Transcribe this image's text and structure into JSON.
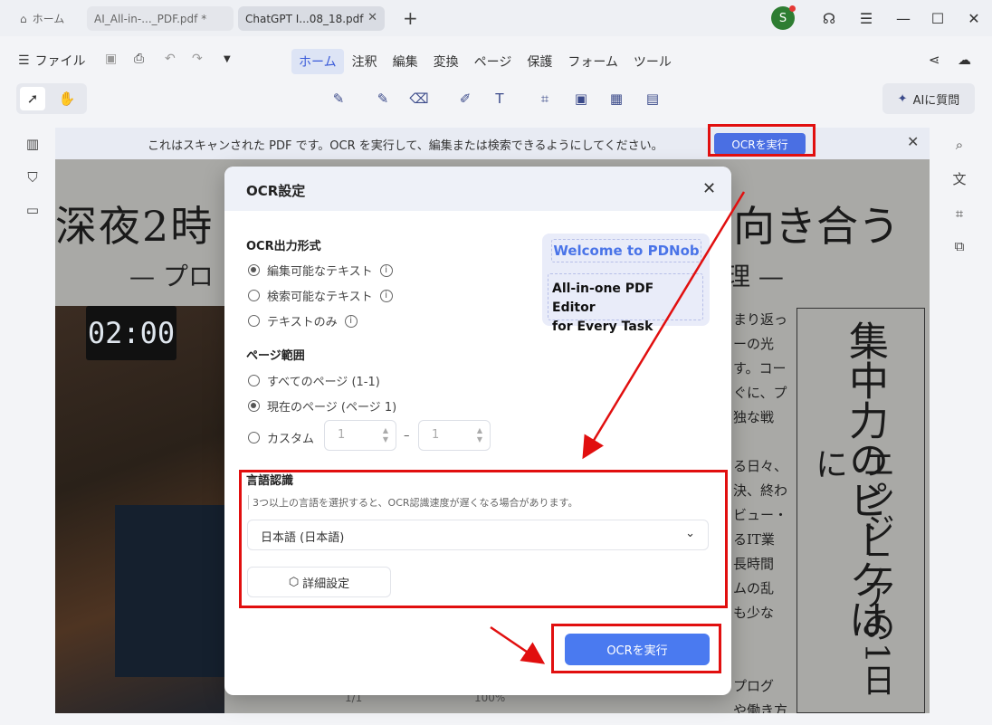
{
  "tabs": [
    {
      "label": "ホーム",
      "icon": "home-icon"
    },
    {
      "label": "AI_All-in-..._PDF.pdf *"
    },
    {
      "label": "ChatGPT I...08_18.pdf"
    }
  ],
  "avatar": {
    "initial": "S"
  },
  "menubar": {
    "file_label": "ファイル",
    "tabs": [
      "ホーム",
      "注釈",
      "編集",
      "変換",
      "ページ",
      "保護",
      "フォーム",
      "ツール"
    ],
    "active_tab": "ホーム"
  },
  "toolbar": {
    "ai_label": "AIに質問"
  },
  "notice": {
    "text": "これはスキャンされた PDF です。OCR を実行して、編集または検索できるようにしてください。",
    "button": "OCRを実行"
  },
  "document": {
    "headline_left": "深夜2時",
    "headline_right": "向き合う",
    "subline_left": "— プロ",
    "subline_right": "理 —",
    "clock": "02:00",
    "column_lines": [
      "まり返っ",
      "ーの光",
      "す。コー",
      "ぐに、プ",
      "独な戦",
      "",
      "る日々、",
      "決、終わ",
      "ビュー・",
      "るIT業",
      "長時間",
      "ムの乱",
      "も少な",
      "",
      "",
      "プログ",
      "や働き方の"
    ],
    "vertical_big": "集中力のピークは",
    "vertical_mid": "エンジニアの1日に",
    "pager": "1/1",
    "zoom": "100%"
  },
  "dialog": {
    "title": "OCR設定",
    "output_format": {
      "title": "OCR出力形式",
      "options": [
        "編集可能なテキスト",
        "検索可能なテキスト",
        "テキストのみ"
      ],
      "selected": 0
    },
    "page_range": {
      "title": "ページ範囲",
      "options": [
        "すべてのページ (1-1)",
        "現在のページ (ページ 1)",
        "カスタム"
      ],
      "selected": 1,
      "from": "1",
      "to": "1"
    },
    "promo": {
      "line1": "Welcome to PDNob",
      "line2a": "All-in-one PDF Editor",
      "line2b": "for Every Task"
    },
    "language": {
      "title": "言語認識",
      "note": "3つ以上の言語を選択すると、OCR認識速度が遅くなる場合があります。",
      "selected": "日本語 (日本語)"
    },
    "advanced_label": "詳細設定",
    "run_label": "OCRを実行"
  },
  "colors": {
    "accent": "#4a7af0",
    "highlight": "#e10f0f",
    "avatar_bg": "#2e7d32"
  }
}
